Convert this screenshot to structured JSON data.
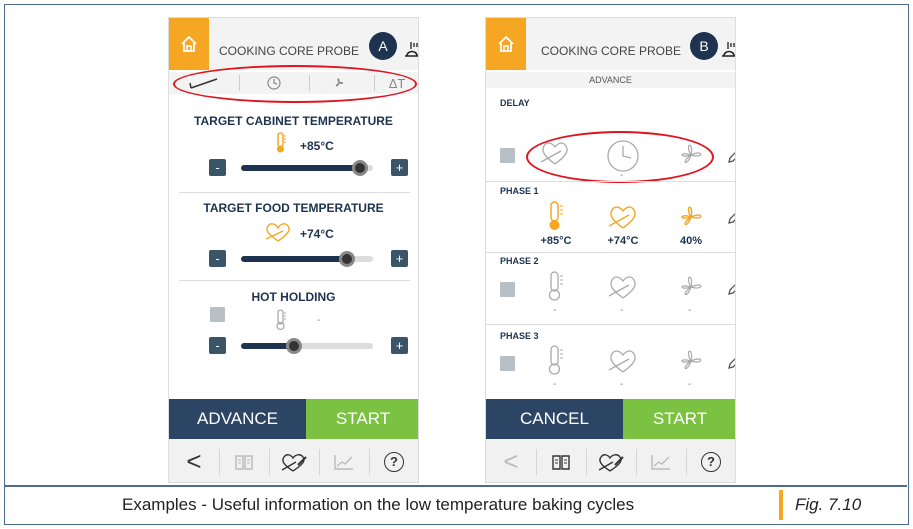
{
  "screen_a": {
    "header_title": "COOKING CORE PROBE",
    "badge": "A",
    "tab_delta": "ΔT",
    "cabinet": {
      "title": "TARGET CABINET TEMPERATURE",
      "value": "+85°C",
      "level": 0.9
    },
    "food": {
      "title": "TARGET  FOOD TEMPERATURE",
      "value": "+74°C",
      "level": 0.8
    },
    "holding": {
      "title": "HOT HOLDING",
      "value": "-",
      "level": 0.4
    },
    "minus": "-",
    "plus": "+",
    "btn_left": "ADVANCE",
    "btn_right": "START"
  },
  "screen_b": {
    "header_title": "COOKING CORE PROBE",
    "badge": "B",
    "advance_label": "ADVANCE",
    "delay_label": "DELAY",
    "delay_values": [
      "-"
    ],
    "phase1": {
      "label": "PHASE 1",
      "values": [
        "+85°C",
        "+74°C",
        "40%"
      ]
    },
    "phase2": {
      "label": "PHASE 2",
      "values": [
        "-",
        "-",
        "-"
      ]
    },
    "phase3": {
      "label": "PHASE 3",
      "values": [
        "-",
        "-",
        "-"
      ]
    },
    "btn_left": "CANCEL",
    "btn_right": "START"
  },
  "bottom_nav": {
    "back": "<",
    "help": "?"
  },
  "caption": {
    "text": "Examples - Useful information on the low temperature baking cycles",
    "figure": "Fig. 7.10"
  },
  "colors": {
    "accent": "#f5a623",
    "navy": "#2d4565",
    "green": "#7bc242",
    "highlight": "#e0141e"
  }
}
